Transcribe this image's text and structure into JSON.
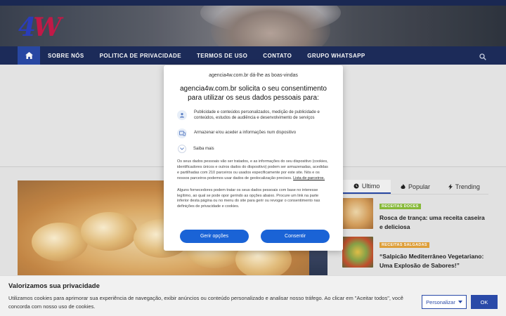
{
  "site": {
    "logo": {
      "digit": "4",
      "letter": "W"
    }
  },
  "nav": {
    "items": [
      {
        "label": "SOBRE NÓS"
      },
      {
        "label": "POLITICA DE PRIVACIDADE"
      },
      {
        "label": "TERMOS DE USO"
      },
      {
        "label": "CONTATO"
      },
      {
        "label": "GRUPO WHATSAPP"
      }
    ]
  },
  "sidebar": {
    "tabs": [
      {
        "label": "Ultimo",
        "icon": "clock-icon"
      },
      {
        "label": "Popular",
        "icon": "flame-icon"
      },
      {
        "label": "Trending",
        "icon": "bolt-icon"
      }
    ],
    "posts": [
      {
        "category": "RECEITAS DOCES",
        "category_color": "#8bbf3a",
        "title": "Rosca de trança: uma receita caseira e deliciosa"
      },
      {
        "category": "RECEITAS SALGADAS",
        "category_color": "#e6a43a",
        "title": "“Salpicão Mediterrâneo Vegetariano: Uma Explosão de Sabores!”"
      }
    ]
  },
  "consent": {
    "site_greeting": "agencia4w.com.br dá-lhe as boas-vindas",
    "heading": "agencia4w.com.br solicita o seu consentimento para utilizar os seus dados pessoais para:",
    "purposes": [
      {
        "icon": "person-icon",
        "text": "Publicidade e conteúdos personalizados, medição de publicidade e conteúdos, estudos de audiência e desenvolvimento de serviços"
      },
      {
        "icon": "device-icon",
        "text": "Armazenar e/ou aceder a informações num dispositivo"
      }
    ],
    "learn_more": "Saiba mais",
    "paragraph1": "Os seus dados pessoais vão ser tratados, e as informações do seu dispositivo (cookies, identificadores únicos e outros dados do dispositivo) podem ser armazenadas, acedidas e partilhadas com 210 parceiros ou usados especificamente por este site. Nós e os nossos parceiros podemos usar dados de geolocalização precisos.",
    "partners_link": "Lista de parceiros.",
    "paragraph2": "Alguns fornecedores podem tratar os seus dados pessoais com base no interesse legítimo, ao qual se pode opor gerindo as opções abaixo. Procure um link na parte inferior desta página ou no menu do site para gerir ou revogar o consentimento nas definições de privacidade e cookies.",
    "manage_label": "Gerir opções",
    "consent_label": "Consentir"
  },
  "cookie_bar": {
    "title": "Valorizamos sua privacidade",
    "text": "Utilizamos cookies para aprimorar sua experiência de navegação, exibir anúncios ou conteúdo personalizado e analisar nosso tráfego. Ao clicar em \"Aceitar todos\", você concorda com nosso uso de cookies.",
    "customize_label": "Personalizar",
    "ok_label": "OK"
  },
  "colors": {
    "nav_bg": "#1d2d5c",
    "accent": "#2a4aa8",
    "consent_button": "#1a63d6"
  }
}
